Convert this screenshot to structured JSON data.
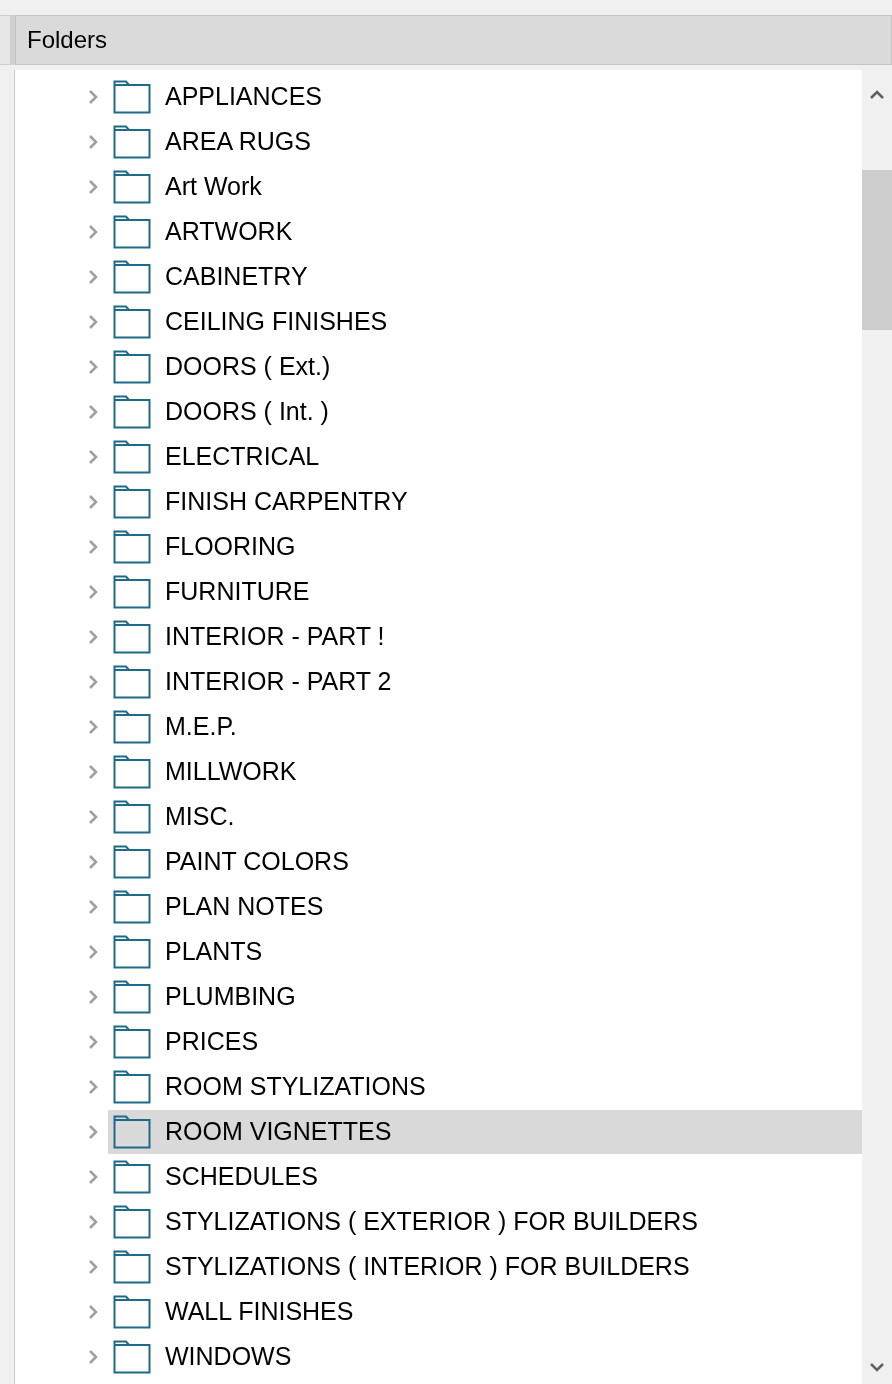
{
  "header": {
    "title": "Folders"
  },
  "folders": [
    {
      "label": "APPLIANCES",
      "selected": false
    },
    {
      "label": "AREA RUGS",
      "selected": false
    },
    {
      "label": "Art Work",
      "selected": false
    },
    {
      "label": "ARTWORK",
      "selected": false
    },
    {
      "label": "CABINETRY",
      "selected": false
    },
    {
      "label": "CEILING FINISHES",
      "selected": false
    },
    {
      "label": "DOORS ( Ext.)",
      "selected": false
    },
    {
      "label": "DOORS ( Int. )",
      "selected": false
    },
    {
      "label": "ELECTRICAL",
      "selected": false
    },
    {
      "label": "FINISH CARPENTRY",
      "selected": false
    },
    {
      "label": "FLOORING",
      "selected": false
    },
    {
      "label": "FURNITURE",
      "selected": false
    },
    {
      "label": "INTERIOR - PART !",
      "selected": false
    },
    {
      "label": "INTERIOR - PART 2",
      "selected": false
    },
    {
      "label": "M.E.P.",
      "selected": false
    },
    {
      "label": "MILLWORK",
      "selected": false
    },
    {
      "label": "MISC.",
      "selected": false
    },
    {
      "label": "PAINT COLORS",
      "selected": false
    },
    {
      "label": "PLAN NOTES",
      "selected": false
    },
    {
      "label": "PLANTS",
      "selected": false
    },
    {
      "label": "PLUMBING",
      "selected": false
    },
    {
      "label": "PRICES",
      "selected": false
    },
    {
      "label": "ROOM STYLIZATIONS",
      "selected": false
    },
    {
      "label": "ROOM VIGNETTES",
      "selected": true
    },
    {
      "label": "SCHEDULES",
      "selected": false
    },
    {
      "label": "STYLIZATIONS ( EXTERIOR ) FOR BUILDERS",
      "selected": false
    },
    {
      "label": "STYLIZATIONS ( INTERIOR ) FOR BUILDERS",
      "selected": false
    },
    {
      "label": "WALL FINISHES",
      "selected": false
    },
    {
      "label": "WINDOWS",
      "selected": false
    }
  ]
}
